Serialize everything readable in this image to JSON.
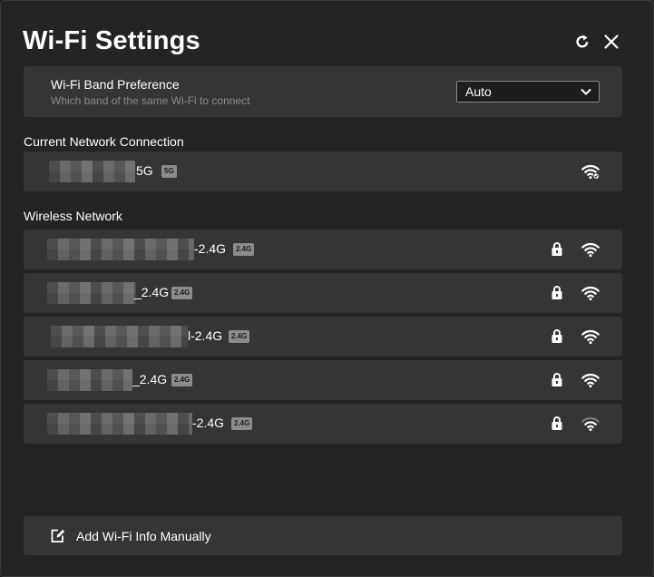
{
  "dialog": {
    "title": "Wi-Fi Settings",
    "refresh_icon": "refresh-icon",
    "close_icon": "close-icon"
  },
  "band_preference": {
    "title": "Wi-Fi Band Preference",
    "description": "Which band of the same Wi-Fi to connect",
    "selected": "Auto"
  },
  "current_connection": {
    "label": "Current Network Connection",
    "network": {
      "ssid_visible_suffix": "5G",
      "band": "5G",
      "signal_level": 4,
      "secured": true
    }
  },
  "wireless": {
    "label": "Wireless Network",
    "networks": [
      {
        "ssid_visible_suffix": "-2.4G",
        "band": "2.4G",
        "secured": true,
        "signal_level": 4
      },
      {
        "ssid_visible_suffix": "_2.4G",
        "band": "2.4G",
        "secured": true,
        "signal_level": 4
      },
      {
        "ssid_visible_suffix": "l-2.4G",
        "band": "2.4G",
        "secured": true,
        "signal_level": 4
      },
      {
        "ssid_visible_suffix": "_2.4G",
        "band": "2.4G",
        "secured": true,
        "signal_level": 4
      },
      {
        "ssid_visible_suffix": "-2.4G",
        "band": "2.4G",
        "secured": true,
        "signal_level": 2
      }
    ]
  },
  "manual": {
    "label": "Add Wi-Fi Info Manually",
    "icon": "edit-icon"
  },
  "colors": {
    "background": "#242424",
    "card": "#353535",
    "muted_text": "#8c8c8c",
    "badge": "#8c8c8c"
  }
}
